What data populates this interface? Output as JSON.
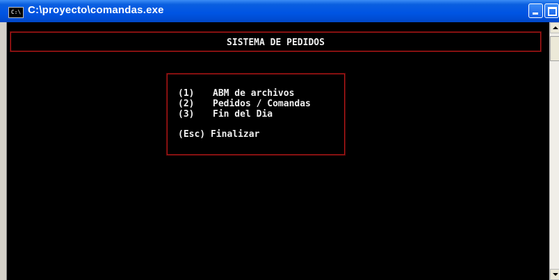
{
  "window": {
    "title": "C:\\proyecto\\comandas.exe",
    "icon_label": "C:\\"
  },
  "console": {
    "header": "SISTEMA DE PEDIDOS",
    "menu": [
      {
        "key": "(1)",
        "label": "ABM de archivos"
      },
      {
        "key": "(2)",
        "label": "Pedidos / Comandas"
      },
      {
        "key": "(3)",
        "label": "Fin del Dia"
      }
    ],
    "exit": {
      "key": "(Esc)",
      "label": "Finalizar"
    }
  },
  "colors": {
    "title_bar": "#0054e3",
    "console_bg": "#000000",
    "console_text": "#f0f0f0",
    "frame_border": "#b01818"
  }
}
